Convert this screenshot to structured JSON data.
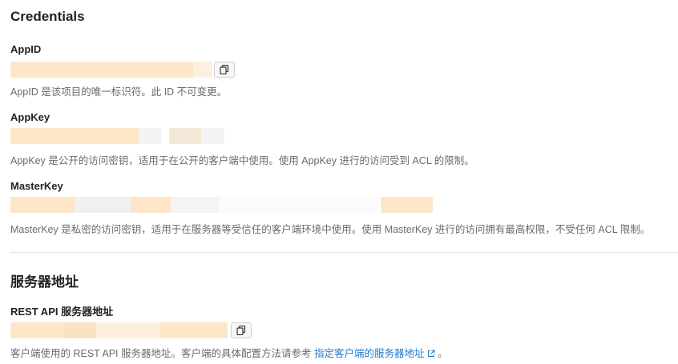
{
  "credentials": {
    "title": "Credentials",
    "appid": {
      "label": "AppID",
      "hint": "AppID 是该项目的唯一标识符。此 ID 不可变更。"
    },
    "appkey": {
      "label": "AppKey",
      "hint": "AppKey 是公开的访问密钥，适用于在公开的客户端中使用。使用 AppKey 进行的访问受到 ACL 的限制。"
    },
    "masterkey": {
      "label": "MasterKey",
      "hint": "MasterKey 是私密的访问密钥，适用于在服务器等受信任的客户端环境中使用。使用 MasterKey 进行的访问拥有最高权限，不受任何 ACL 限制。"
    }
  },
  "server": {
    "title": "服务器地址",
    "rest": {
      "label": "REST API 服务器地址",
      "hint_prefix": "客户端使用的 REST API 服务器地址。客户端的具体配置方法请参考",
      "link_text": "指定客户端的服务器地址",
      "hint_suffix": "。"
    }
  },
  "icons": {
    "copy": "copy-icon",
    "external": "external-link-icon"
  },
  "colors": {
    "link": "#1f7acc",
    "masked_value": "#fde6c8"
  }
}
